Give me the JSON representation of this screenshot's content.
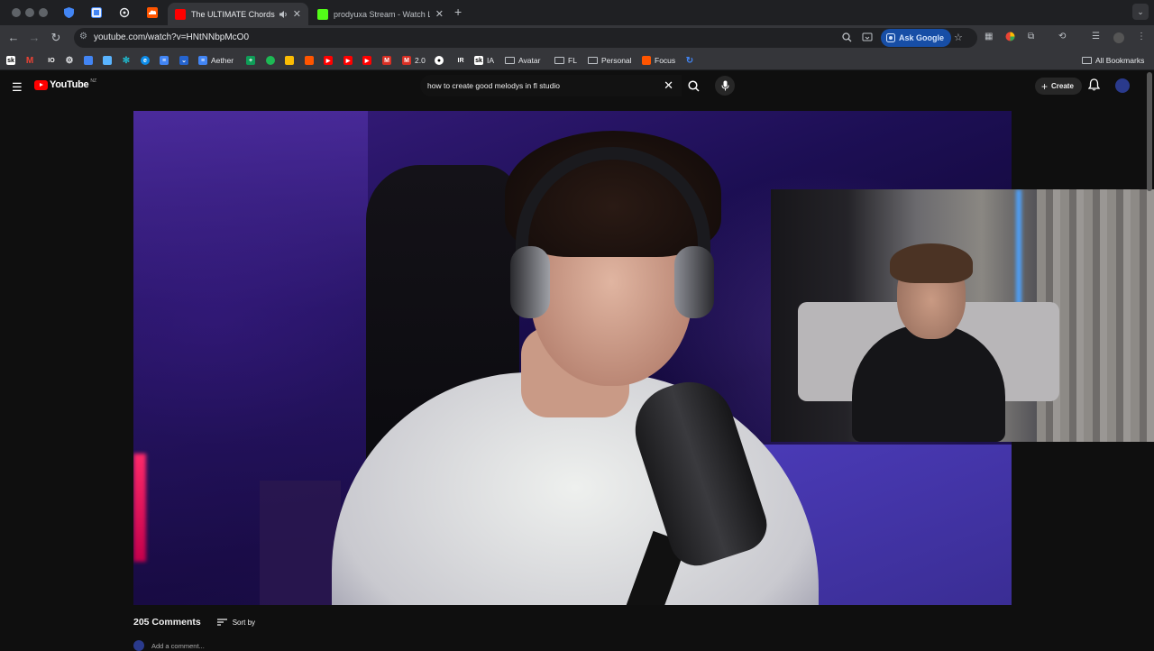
{
  "browser": {
    "tabs": [
      {
        "title": "The ULTIMATE Chords &",
        "active": true,
        "favicon_color": "#ff0000"
      },
      {
        "title": "prodyuxa Stream - Watch Live",
        "active": false,
        "favicon_color": "#53fc18"
      }
    ],
    "url": "youtube.com/watch?v=HNtNNbpMcO0",
    "ask_google_label": "Ask Google",
    "bookmarks": {
      "aether": "Aether",
      "version": "2.0",
      "ia": "IA",
      "avatar": "Avatar",
      "fl": "FL",
      "personal": "Personal",
      "focus": "Focus",
      "all_bookmarks": "All Bookmarks"
    }
  },
  "youtube": {
    "logo_text": "YouTube",
    "region": "NZ",
    "search_query": "how to create good melodys in fl studio",
    "create_label": "Create",
    "comments": {
      "count_label": "205 Comments",
      "sort_label": "Sort by",
      "add_placeholder": "Add a comment..."
    }
  },
  "colors": {
    "brand_red": "#ff0000",
    "ask_google_bg": "#174ea6",
    "page_bg": "#0f0f0f"
  }
}
